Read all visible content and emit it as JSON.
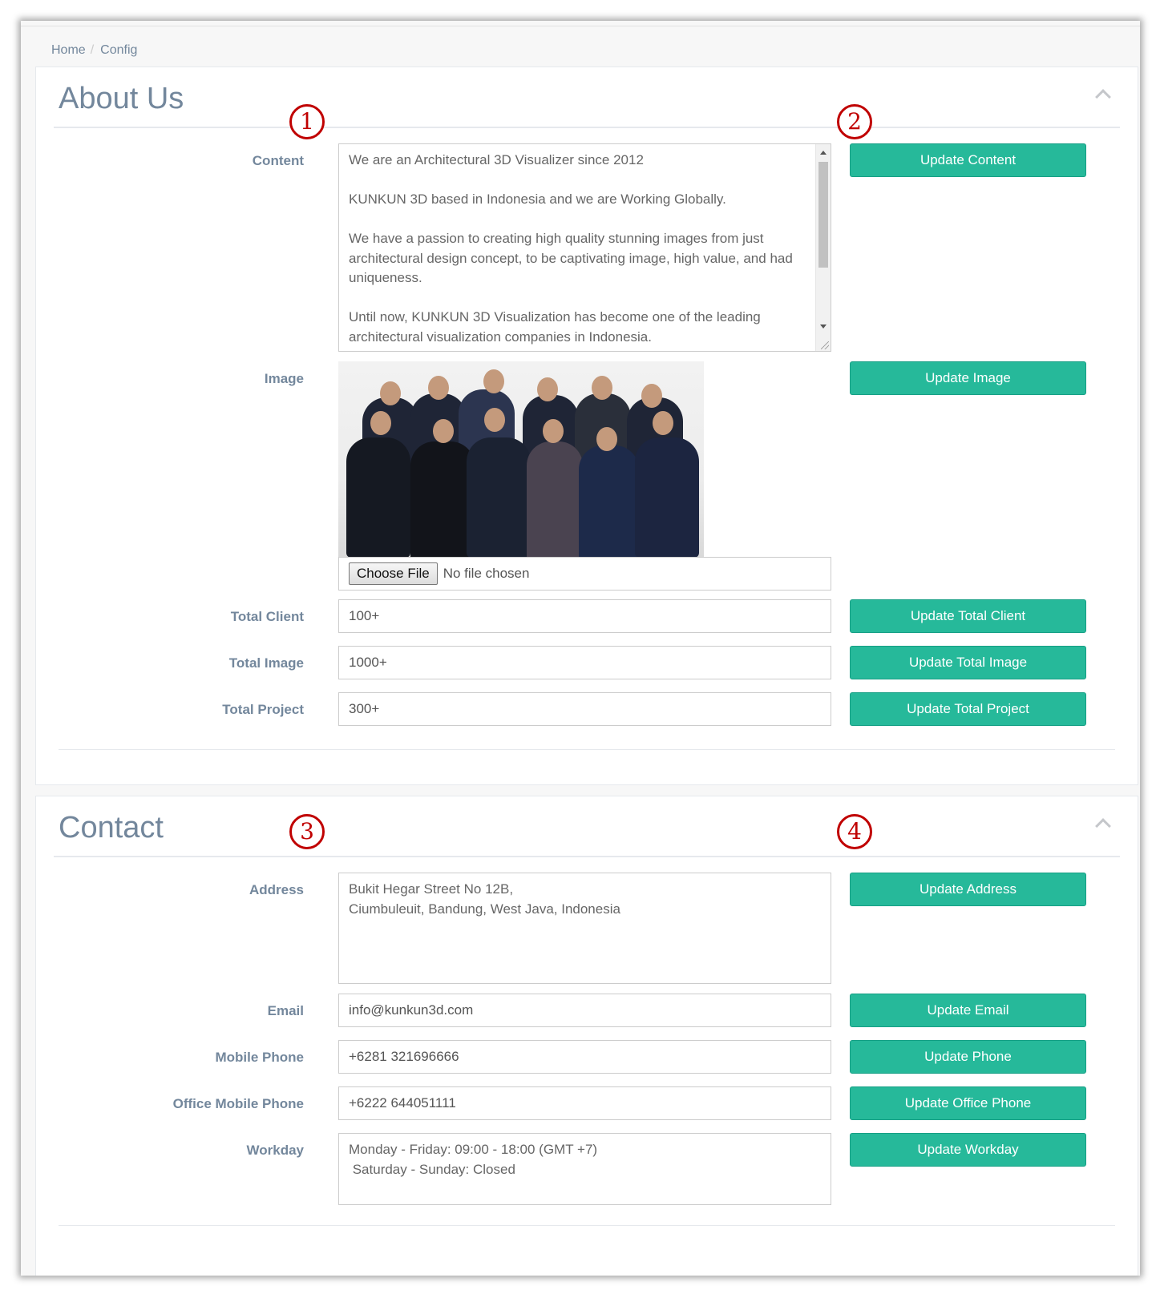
{
  "breadcrumb": {
    "home": "Home",
    "current": "Config"
  },
  "about": {
    "title": "About Us",
    "annot_left": "1",
    "annot_right": "2",
    "content_label": "Content",
    "content_paragraphs": [
      "We are an Architectural 3D Visualizer since 2012",
      "KUNKUN 3D based in Indonesia and we are Working Globally.",
      "We have a passion to creating high quality stunning images from just architectural design concept, to be captivating image, high value, and had uniqueness.",
      "Until now, KUNKUN 3D Visualization has become one of the leading architectural visualization companies in Indonesia."
    ],
    "update_content": "Update Content",
    "image_label": "Image",
    "choose_file": "Choose File",
    "no_file": "No file chosen",
    "update_image": "Update Image",
    "total_client_label": "Total Client",
    "total_client_value": "100+",
    "update_total_client": "Update Total Client",
    "total_image_label": "Total Image",
    "total_image_value": "1000+",
    "update_total_image": "Update Total Image",
    "total_project_label": "Total Project",
    "total_project_value": "300+",
    "update_total_project": "Update Total Project"
  },
  "contact": {
    "title": "Contact",
    "annot_left": "3",
    "annot_right": "4",
    "address_label": "Address",
    "address_lines": [
      "Bukit Hegar Street No 12B,",
      "Ciumbuleuit, Bandung, West Java, Indonesia"
    ],
    "update_address": "Update Address",
    "email_label": "Email",
    "email_value": "info@kunkun3d.com",
    "update_email": "Update Email",
    "mobile_label": "Mobile Phone",
    "mobile_value": "+6281 321696666",
    "update_phone": "Update Phone",
    "office_label": "Office Mobile Phone",
    "office_value": "+6222 644051111",
    "update_office": "Update Office Phone",
    "workday_label": "Workday",
    "workday_lines": [
      "Monday - Friday: 09:00 - 18:00 (GMT +7)",
      " Saturday - Sunday: Closed"
    ],
    "update_workday": "Update Workday"
  },
  "colors": {
    "accent": "#26b99a",
    "annotation": "#c00000",
    "label": "#73879c"
  }
}
